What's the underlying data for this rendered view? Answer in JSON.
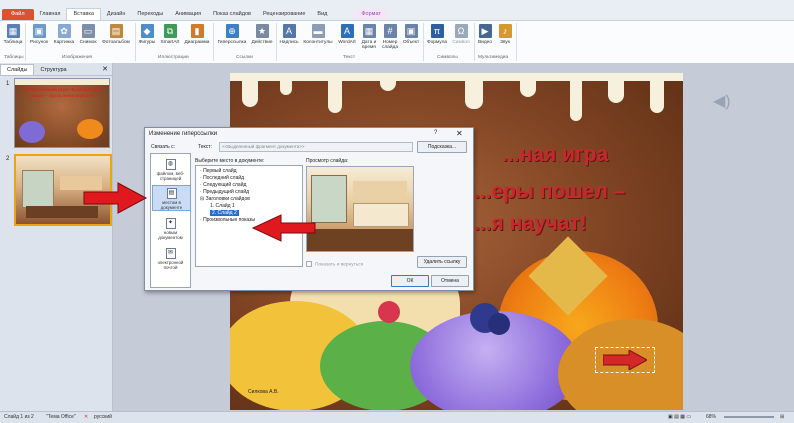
{
  "ribbon": {
    "tabs": [
      {
        "label": "Файл"
      },
      {
        "label": "Главная"
      },
      {
        "label": "Вставка"
      },
      {
        "label": "Дизайн"
      },
      {
        "label": "Переходы"
      },
      {
        "label": "Анимация"
      },
      {
        "label": "Показ слайдов"
      },
      {
        "label": "Рецензирование"
      },
      {
        "label": "Вид"
      },
      {
        "label": "Формат"
      }
    ],
    "buttons": [
      {
        "label": "Таблица",
        "icon": "table-icon"
      },
      {
        "label": "Рисунок",
        "icon": "picture-icon"
      },
      {
        "label": "Картинка",
        "icon": "clipart-icon"
      },
      {
        "label": "Снимок",
        "icon": "screenshot-icon"
      },
      {
        "label": "Фотоальбом",
        "icon": "photo-album-icon"
      },
      {
        "label": "Фигуры",
        "icon": "shapes-icon"
      },
      {
        "label": "SmartArt",
        "icon": "smartart-icon"
      },
      {
        "label": "Диаграмма",
        "icon": "chart-icon"
      },
      {
        "label": "Гиперссылка",
        "icon": "hyperlink-icon"
      },
      {
        "label": "Действие",
        "icon": "action-icon"
      },
      {
        "label": "Надпись",
        "icon": "textbox-icon"
      },
      {
        "label": "Колонтитулы",
        "icon": "header-footer-icon"
      },
      {
        "label": "WordArt",
        "icon": "wordart-icon"
      },
      {
        "label": "Дата и время",
        "icon": "date-time-icon"
      },
      {
        "label": "Номер слайда",
        "icon": "slide-number-icon"
      },
      {
        "label": "Объект",
        "icon": "object-icon"
      },
      {
        "label": "Формула",
        "icon": "equation-icon"
      },
      {
        "label": "Символ",
        "icon": "symbol-icon"
      },
      {
        "label": "Видео",
        "icon": "video-icon"
      },
      {
        "label": "Звук",
        "icon": "audio-icon"
      }
    ],
    "groups": [
      {
        "label": "Таблицы"
      },
      {
        "label": "Изображения"
      },
      {
        "label": "Иллюстрации"
      },
      {
        "label": "Ссылки"
      },
      {
        "label": "Текст"
      },
      {
        "label": "Символы"
      },
      {
        "label": "Мультимедиа"
      }
    ]
  },
  "left_panel": {
    "tab_slides": "Слайды",
    "tab_outline": "Структура",
    "close": "✕",
    "slide_numbers": [
      "1",
      "2"
    ],
    "slide1_text": "Интерактивная игра «В кондитеры пошел – пусть меня научат!»"
  },
  "slide": {
    "title_line1": "...ная игра",
    "title_line2": "...еры пошел –",
    "title_line3": "...я научат!",
    "author": "Силкова А.В."
  },
  "dialog": {
    "title": "Изменение гиперссылки",
    "help": "?",
    "close": "✕",
    "link_to_label": "Связать с:",
    "text_label": "Текст:",
    "text_value": "<<Выделенный фрагмент документа>>",
    "tooltip_button": "Подсказка...",
    "sidebar": [
      {
        "label": "файлом, веб-страницей",
        "icon": "web-page-icon"
      },
      {
        "label": "местом в документе",
        "icon": "place-in-document-icon"
      },
      {
        "label": "новым документом",
        "icon": "new-document-icon"
      },
      {
        "label": "электронной почтой",
        "icon": "email-icon"
      }
    ],
    "place_label": "Выберите место в документе:",
    "places": [
      {
        "label": "Первый слайд"
      },
      {
        "label": "Последний слайд"
      },
      {
        "label": "Следующий слайд"
      },
      {
        "label": "Предыдущий слайд"
      },
      {
        "label": "Заголовки слайдов"
      },
      {
        "label": "1. Слайд 1"
      },
      {
        "label": "2. Слайд 2"
      },
      {
        "label": "Произвольные показы"
      }
    ],
    "preview_label": "Просмотр слайда:",
    "show_and_return": "Показать и вернуться",
    "remove_link": "Удалить ссылку",
    "ok": "ОК",
    "cancel": "Отмена"
  },
  "status": {
    "slide_of": "Слайд 1 из 2",
    "theme": "\"Тема Office\"",
    "language": "русский",
    "zoom": "68%"
  },
  "colors": {
    "accent_red": "#c9272e",
    "file_tab": "#d9532c",
    "selection": "#316ac5"
  }
}
